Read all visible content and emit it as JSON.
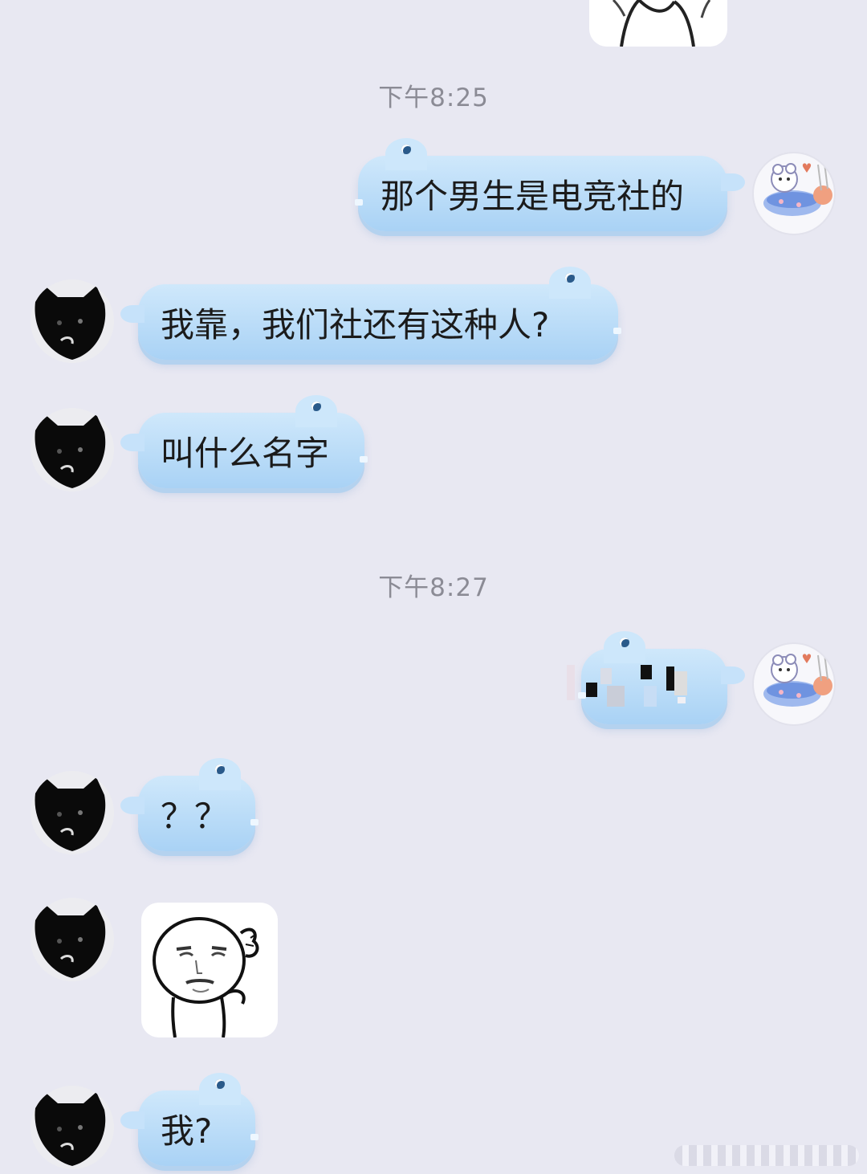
{
  "chat": {
    "timestamps": [
      "下午8:25",
      "下午8:27"
    ],
    "messages": [
      {
        "sender": "self",
        "text": "那个男生是电竞社的"
      },
      {
        "sender": "other",
        "text": "我靠，我们社还有这种人?"
      },
      {
        "sender": "other",
        "text": "叫什么名字"
      },
      {
        "sender": "self",
        "text": "\u0000",
        "redacted": true
      },
      {
        "sender": "other",
        "text": "？？"
      },
      {
        "sender": "other",
        "sticker": "thinking-meme-face"
      },
      {
        "sender": "other",
        "text": "我?"
      }
    ]
  },
  "colors": {
    "background": "#e8e8f2",
    "bubble_top": "#cfe8fb",
    "bubble_bottom": "#a9d2f5",
    "timestamp": "#8b8b95"
  },
  "icons": {
    "other_avatar": "black-cat-avatar-icon",
    "self_avatar": "cartoon-bear-avatar-icon"
  }
}
